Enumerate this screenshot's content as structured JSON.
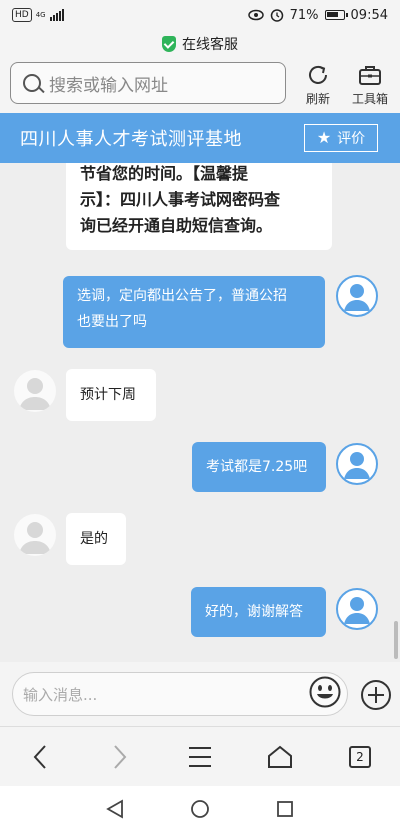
{
  "status_bar": {
    "network_badge": "HD",
    "network_type": "4G",
    "battery_percent": "71%",
    "time": "09:54"
  },
  "service_banner": {
    "label": "在线客服",
    "icon": "shield-check-icon",
    "color": "#2fb45a"
  },
  "browser": {
    "search_placeholder": "搜索或输入网址",
    "refresh_label": "刷新",
    "toolbox_label": "工具箱"
  },
  "header": {
    "title": "四川人事人才考试测评基地",
    "rate_label": "评价",
    "accent_color": "#5aa3e6"
  },
  "chat": {
    "top_message_lines": [
      "节省您的时间。【温馨提",
      "示】：四川人事考试网密码查",
      "询已经开通自助短信查询。"
    ],
    "messages": [
      {
        "side": "right",
        "lines": [
          "选调，定向都出公告了，普通公招",
          "也要出了吗"
        ]
      },
      {
        "side": "left",
        "lines": [
          "预计下周"
        ]
      },
      {
        "side": "right",
        "lines": [
          "考试都是7.25吧"
        ]
      },
      {
        "side": "left",
        "lines": [
          "是的"
        ]
      },
      {
        "side": "right",
        "lines": [
          "好的，谢谢解答"
        ]
      }
    ]
  },
  "composer": {
    "placeholder": "输入消息..."
  },
  "browser_nav": {
    "tab_count": "2"
  }
}
